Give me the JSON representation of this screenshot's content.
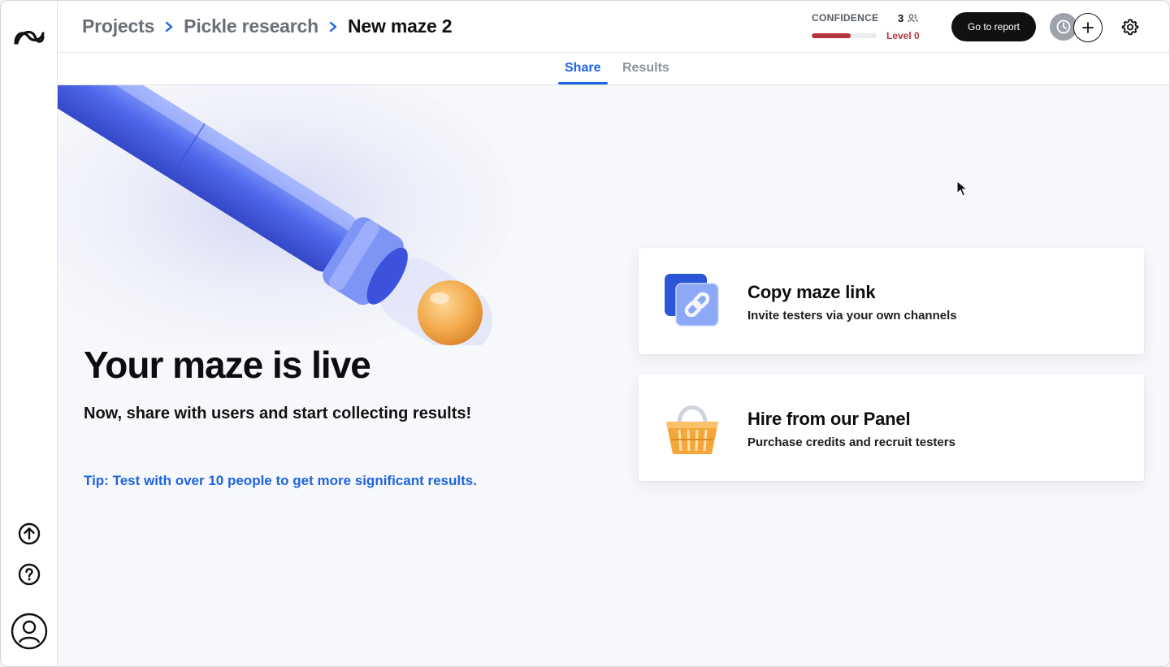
{
  "breadcrumb": {
    "items": [
      "Projects",
      "Pickle research"
    ],
    "current": "New maze 2"
  },
  "confidence": {
    "label": "CONFIDENCE",
    "testers": "3",
    "level": "Level 0",
    "progress_fraction": 0.6,
    "color": "#b3353d"
  },
  "header": {
    "report_button": "Go to report",
    "icons": [
      "history-icon",
      "plus-icon",
      "gear-icon"
    ]
  },
  "tabs": [
    {
      "label": "Share",
      "active": true
    },
    {
      "label": "Results",
      "active": false
    }
  ],
  "hero": {
    "title": "Your maze is live",
    "subtitle": "Now, share with users and start collecting results!",
    "tip": "Tip: Test with over 10 people to get more significant results."
  },
  "cards": [
    {
      "title": "Copy maze link",
      "description": "Invite testers via your own channels",
      "icon": "link-icon"
    },
    {
      "title": "Hire from our Panel",
      "description": "Purchase credits and recruit testers",
      "icon": "basket-icon"
    }
  ],
  "sidebar": {
    "icons": [
      "maze-logo",
      "upgrade-icon",
      "help-icon",
      "user-icon"
    ]
  },
  "colors": {
    "accent": "#1e63e0",
    "danger": "#b3353d",
    "dark": "#111111"
  }
}
